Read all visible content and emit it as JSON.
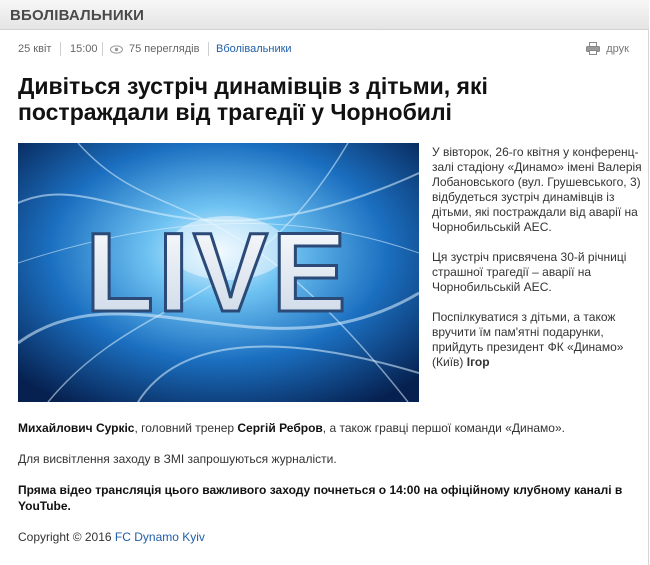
{
  "section": {
    "title": "ВБОЛІВАЛЬНИКИ"
  },
  "meta": {
    "date": "25 квіт",
    "time": "15:00",
    "views": "75 переглядів",
    "category": "Вболівальники",
    "print_label": "друк"
  },
  "article": {
    "title": "Дивіться зустріч динамівців з дітьми, які постраждали від трагедії у Чорнобилі",
    "image_text": "LIVE",
    "side_paragraphs": [
      "У вівторок, 26-го квітня у конференц-залі стадіону «Динамо» імені Валерія Лобановського (вул. Грушевського, 3) відбудеться зустріч динамівців із дітьми, які постраждали від аварії на Чорнобильській АЕС.",
      "Ця зустріч присвячена 30-й річниці страшної трагедії – аварії на Чорнобильській АЕС.",
      "Поспілкуватися з дітьми, а також вручити їм пам'ятні подарунки, прийдуть президент ФК «Динамо» (Київ)"
    ],
    "p3_name1_start": "Ігор",
    "p3_name1_end": "Михайлович Суркіс",
    "p3_mid": ", головний тренер ",
    "p3_name2": "Сергій Ребров",
    "p3_end": ", а також гравці першої команди «Динамо».",
    "p4": "Для висвітлення заходу в ЗМІ запрошуються журналісти.",
    "p5": "Пряма відео трансляція цього важливого заходу почнеться о 14:00 на офіційному клубному каналі в YouTube.",
    "copyright": "Copyright © 2016 ",
    "copyright_link": "FC Dynamo Kyiv"
  }
}
